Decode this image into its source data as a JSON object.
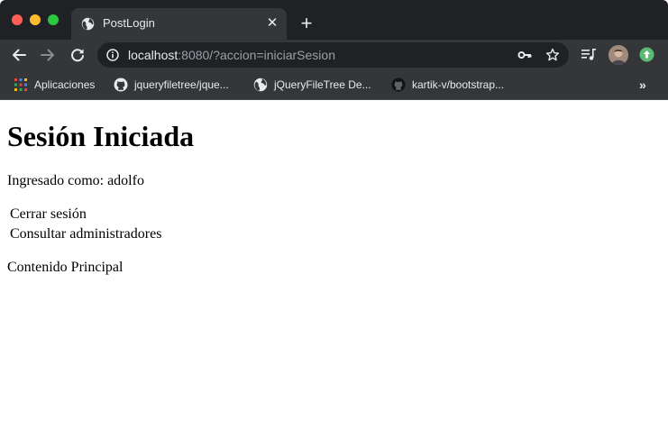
{
  "browser": {
    "tab": {
      "title": "PostLogin",
      "close_glyph": "✕"
    },
    "new_tab_glyph": "+",
    "address": {
      "host": "localhost",
      "rest": ":8080/?accion=iniciarSesion"
    },
    "bookmarks": {
      "items": [
        {
          "label": "Aplicaciones",
          "icon": "apps-grid-icon"
        },
        {
          "label": "jqueryfiletree/jque...",
          "icon": "github-icon"
        },
        {
          "label": "jQueryFileTree De...",
          "icon": "globe-icon"
        },
        {
          "label": "kartik-v/bootstrap...",
          "icon": "github-icon"
        }
      ],
      "more_glyph": "»"
    }
  },
  "page": {
    "title": "Sesión Iniciada",
    "logged_in_text": "Ingresado como: adolfo",
    "menu": {
      "logout": "Cerrar sesión",
      "admins": "Consultar administradores"
    },
    "content_text": "Contenido Principal"
  }
}
